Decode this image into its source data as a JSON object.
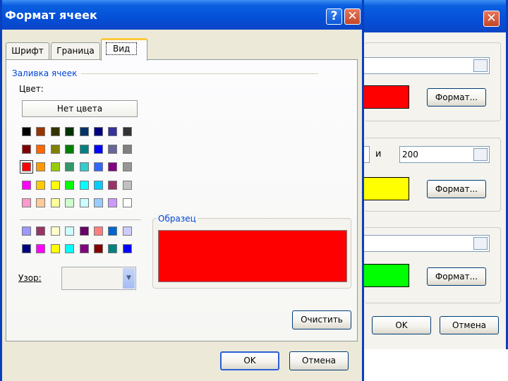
{
  "dialog": {
    "title": "Формат ячеек",
    "tabs": [
      {
        "label": "Шрифт",
        "active": false
      },
      {
        "label": "Граница",
        "active": false
      },
      {
        "label": "Вид",
        "active": true
      }
    ],
    "fill_group_label": "Заливка ячеек",
    "color_label": "Цвет:",
    "no_color_button": "Нет цвета",
    "palette_main": [
      [
        "#000000",
        "#993300",
        "#333300",
        "#003300",
        "#003366",
        "#000080",
        "#333399",
        "#333333"
      ],
      [
        "#800000",
        "#ff6600",
        "#808000",
        "#008000",
        "#008080",
        "#0000ff",
        "#666699",
        "#808080"
      ],
      [
        "#ff0000",
        "#ff9900",
        "#99cc00",
        "#339966",
        "#33cccc",
        "#3366ff",
        "#800080",
        "#969696"
      ],
      [
        "#ff00ff",
        "#ffcc00",
        "#ffff00",
        "#00ff00",
        "#00ffff",
        "#00ccff",
        "#993366",
        "#c0c0c0"
      ],
      [
        "#ff99cc",
        "#ffcc99",
        "#ffff99",
        "#ccffcc",
        "#ccffff",
        "#99ccff",
        "#cc99ff",
        "#ffffff"
      ]
    ],
    "palette_chart": [
      [
        "#9999ff",
        "#993366",
        "#ffffcc",
        "#ccffff",
        "#660066",
        "#ff8080",
        "#0066cc",
        "#ccccff"
      ],
      [
        "#000080",
        "#ff00ff",
        "#ffff00",
        "#00ffff",
        "#800080",
        "#800000",
        "#008080",
        "#0000ff"
      ]
    ],
    "selected_color": "#ff0000",
    "pattern_label": "Узор:",
    "sample_label": "Образец",
    "sample_color": "#ff0000",
    "clear_button": "Очистить",
    "ok_button": "OK",
    "cancel_button": "Отмена"
  },
  "background_dialog": {
    "and_label": "и",
    "value_field": "200",
    "format_button": "Формат...",
    "previews": [
      "#ff0000",
      "#ffff00",
      "#00ff00"
    ],
    "ok_button": "OK",
    "cancel_button": "Отмена"
  }
}
